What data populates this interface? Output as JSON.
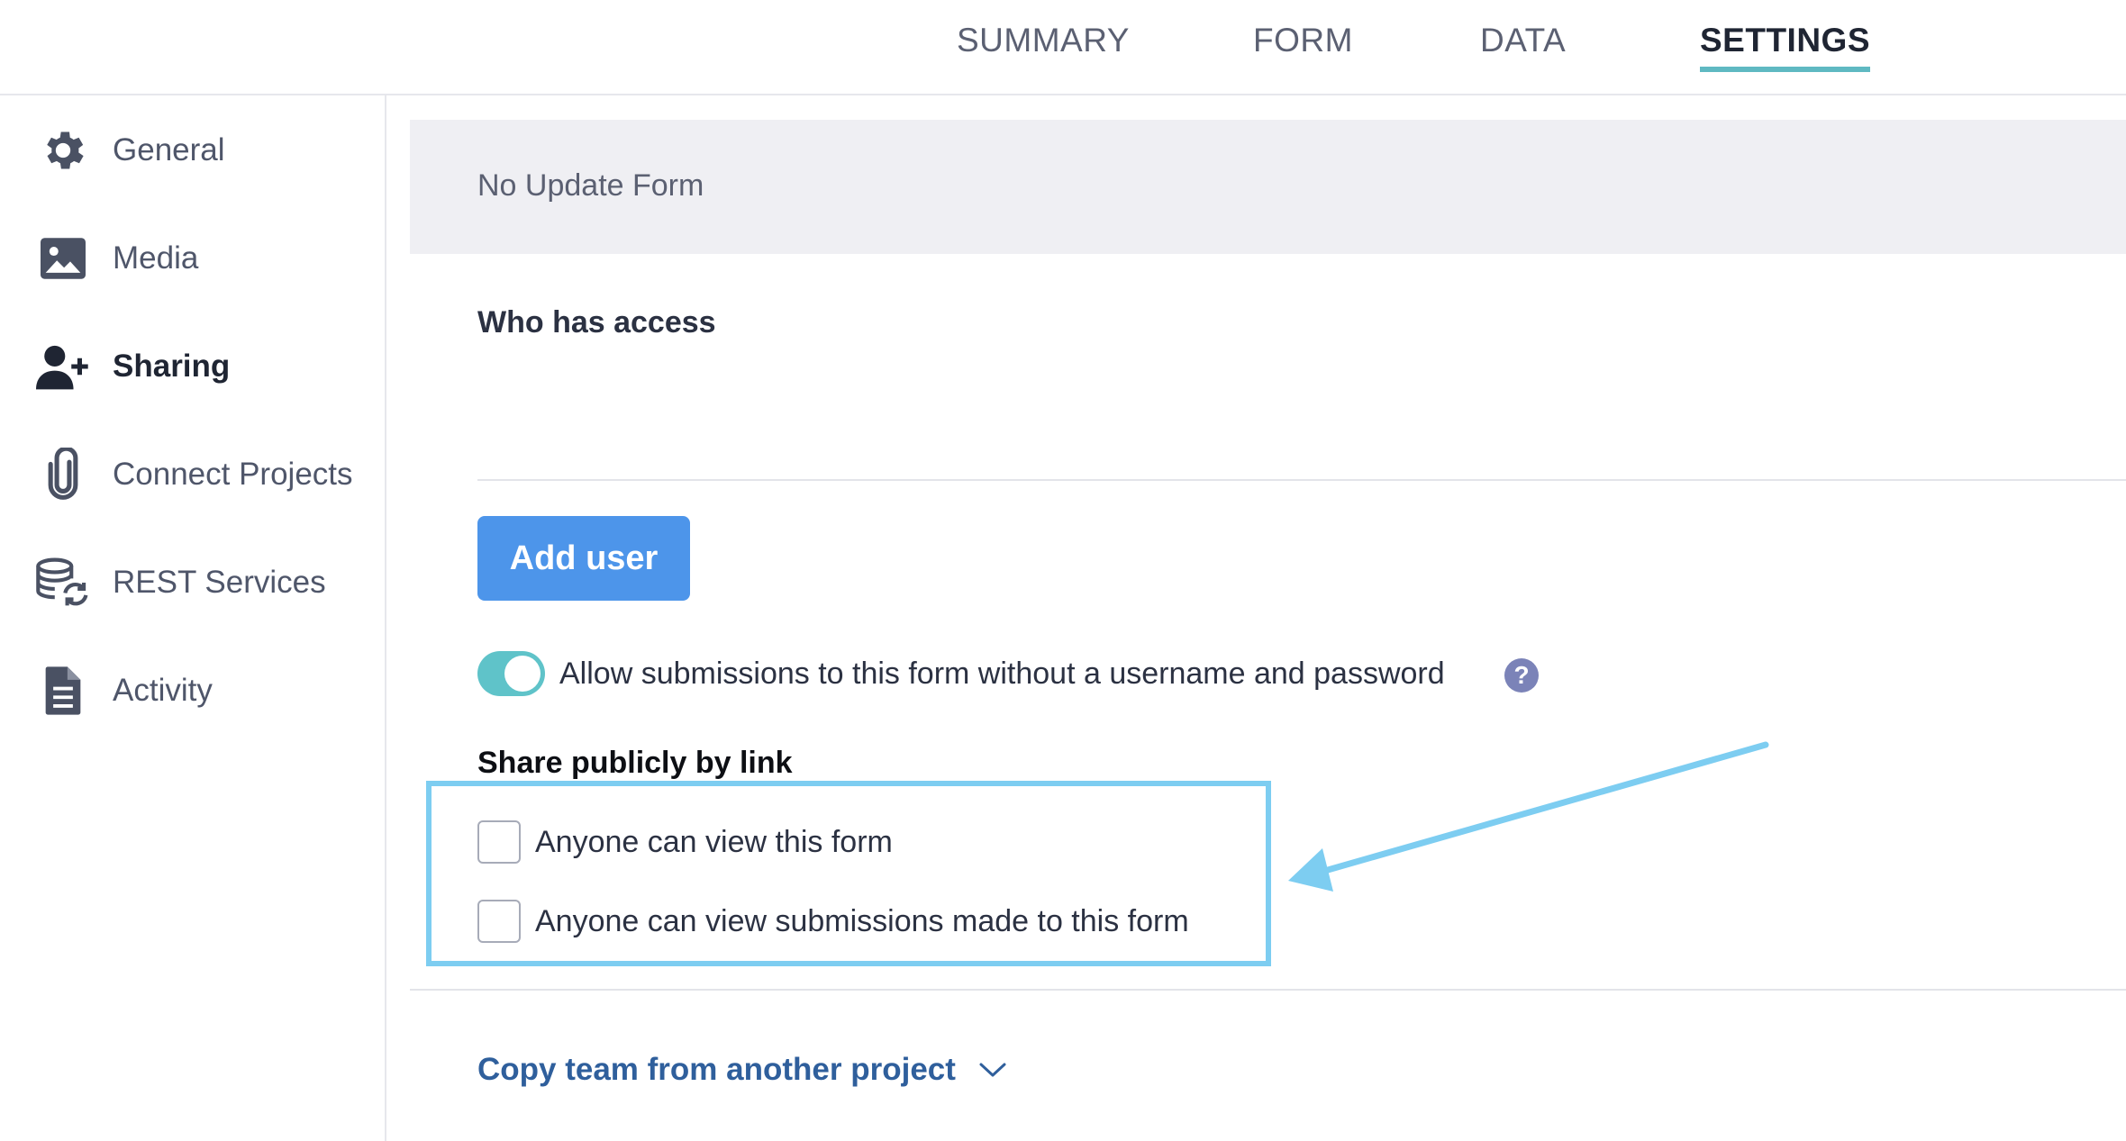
{
  "tabs": {
    "summary": "SUMMARY",
    "form": "FORM",
    "data": "DATA",
    "settings": "SETTINGS",
    "active": "settings"
  },
  "sidebar": {
    "items": [
      {
        "label": "General",
        "icon": "gear-icon"
      },
      {
        "label": "Media",
        "icon": "image-icon"
      },
      {
        "label": "Sharing",
        "icon": "user-add-icon",
        "active": true
      },
      {
        "label": "Connect Projects",
        "icon": "paperclip-icon"
      },
      {
        "label": "REST Services",
        "icon": "database-sync-icon"
      },
      {
        "label": "Activity",
        "icon": "document-icon"
      }
    ]
  },
  "main": {
    "banner_text": "No Update Form",
    "who_has_access": "Who has access",
    "add_user_button": "Add user",
    "allow_toggle": {
      "label": "Allow submissions to this form without a username and password",
      "enabled": true
    },
    "share_heading": "Share publicly by link",
    "share_options": [
      {
        "label": "Anyone can view this form",
        "checked": false
      },
      {
        "label": "Anyone can view submissions made to this form",
        "checked": false
      }
    ],
    "copy_team": "Copy team from another project"
  },
  "colors": {
    "accent_teal": "#5fb9c2",
    "button_blue": "#4d95ea",
    "highlight_blue": "#7dcdf1",
    "link_blue": "#2f5f9c",
    "banner_gray": "#efeff3"
  }
}
